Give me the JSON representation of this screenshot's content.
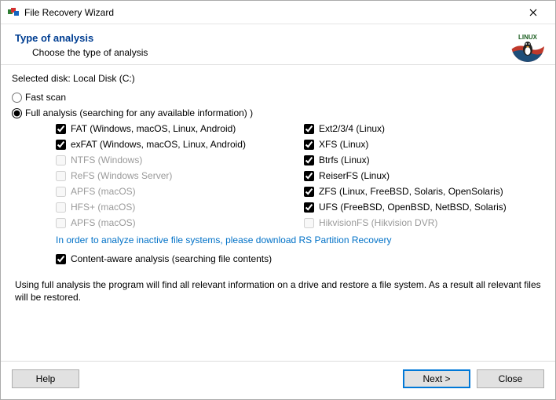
{
  "window": {
    "title": "File Recovery Wizard"
  },
  "header": {
    "heading": "Type of analysis",
    "sub": "Choose the type of analysis"
  },
  "selected_disk": {
    "prefix": "Selected disk: ",
    "value": "Local Disk (C:)"
  },
  "scan": {
    "fast": {
      "label": "Fast scan",
      "selected": false
    },
    "full": {
      "label": "Full analysis (searching for any available information)   )",
      "selected": true
    }
  },
  "filesystems": {
    "left": [
      {
        "label": "FAT (Windows, macOS, Linux, Android)",
        "checked": true,
        "enabled": true
      },
      {
        "label": "exFAT (Windows, macOS, Linux, Android)",
        "checked": true,
        "enabled": true
      },
      {
        "label": "NTFS (Windows)",
        "checked": false,
        "enabled": false
      },
      {
        "label": "ReFS (Windows Server)",
        "checked": false,
        "enabled": false
      },
      {
        "label": "APFS (macOS)",
        "checked": false,
        "enabled": false
      },
      {
        "label": "HFS+ (macOS)",
        "checked": false,
        "enabled": false
      },
      {
        "label": "APFS (macOS)",
        "checked": false,
        "enabled": false
      }
    ],
    "right": [
      {
        "label": "Ext2/3/4 (Linux)",
        "checked": true,
        "enabled": true
      },
      {
        "label": "XFS (Linux)",
        "checked": true,
        "enabled": true
      },
      {
        "label": "Btrfs (Linux)",
        "checked": true,
        "enabled": true
      },
      {
        "label": "ReiserFS (Linux)",
        "checked": true,
        "enabled": true
      },
      {
        "label": "ZFS (Linux, FreeBSD, Solaris, OpenSolaris)",
        "checked": true,
        "enabled": true
      },
      {
        "label": "UFS (FreeBSD, OpenBSD, NetBSD, Solaris)",
        "checked": true,
        "enabled": true
      },
      {
        "label": "HikvisionFS (Hikvision DVR)",
        "checked": false,
        "enabled": false
      }
    ]
  },
  "download_link": "In order to analyze inactive file systems, please download RS Partition Recovery",
  "content_aware": {
    "label": "Content-aware analysis (searching file contents)",
    "checked": true
  },
  "description": "Using full analysis the program will find all relevant information on a drive and restore a file system. As a result all relevant files will be restored.",
  "buttons": {
    "help": "Help",
    "next": "Next >",
    "close": "Close"
  },
  "logo": {
    "text": "LINUX"
  }
}
